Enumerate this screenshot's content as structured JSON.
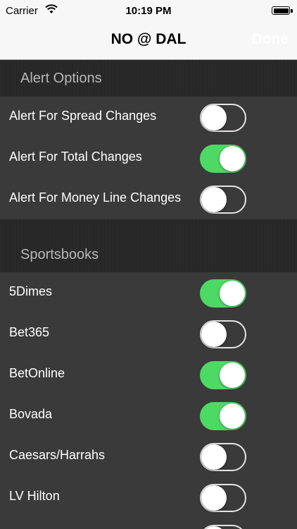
{
  "status_bar": {
    "carrier": "Carrier",
    "time": "10:19 PM"
  },
  "nav": {
    "title": "NO @ DAL",
    "done_label": "Done"
  },
  "alert_options": {
    "header": "Alert Options",
    "items": [
      {
        "label": "Alert For Spread Changes",
        "on": false
      },
      {
        "label": "Alert For Total Changes",
        "on": true
      },
      {
        "label": "Alert For Money Line Changes",
        "on": false
      }
    ]
  },
  "sportsbooks": {
    "header": "Sportsbooks",
    "items": [
      {
        "label": "5Dimes",
        "on": true
      },
      {
        "label": "Bet365",
        "on": false
      },
      {
        "label": "BetOnline",
        "on": true
      },
      {
        "label": "Bovada",
        "on": true
      },
      {
        "label": "Caesars/Harrahs",
        "on": false
      },
      {
        "label": "LV Hilton",
        "on": false
      }
    ]
  },
  "colors": {
    "switch_on": "#4cd964",
    "switch_off_border": "#e5e5e5",
    "row_bg": "#3a3a3a"
  }
}
